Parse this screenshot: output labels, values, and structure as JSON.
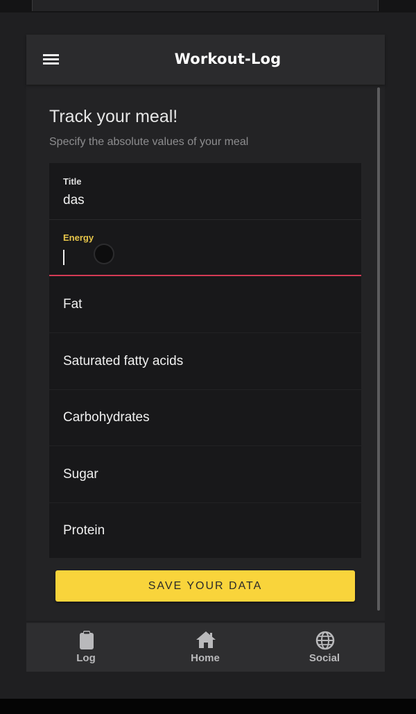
{
  "app": {
    "title": "Workout-Log"
  },
  "page": {
    "heading": "Track your meal!",
    "subheading": "Specify the absolute values of your meal"
  },
  "form": {
    "title_label": "Title",
    "title_value": "das",
    "energy_label": "Energy",
    "energy_value": "",
    "fat_placeholder": "Fat",
    "saturated_placeholder": "Saturated fatty acids",
    "carbohydrates_placeholder": "Carbohydrates",
    "sugar_placeholder": "Sugar",
    "protein_placeholder": "Protein"
  },
  "actions": {
    "save_label": "SAVE YOUR DATA"
  },
  "bottom_nav": {
    "items": [
      {
        "label": "Log",
        "icon": "clipboard-icon"
      },
      {
        "label": "Home",
        "icon": "home-icon"
      },
      {
        "label": "Social",
        "icon": "globe-icon"
      }
    ]
  },
  "colors": {
    "accent": "#f9d43b",
    "focus_label": "#e6c54a",
    "focus_underline": "#d43a55",
    "background": "#232325"
  }
}
